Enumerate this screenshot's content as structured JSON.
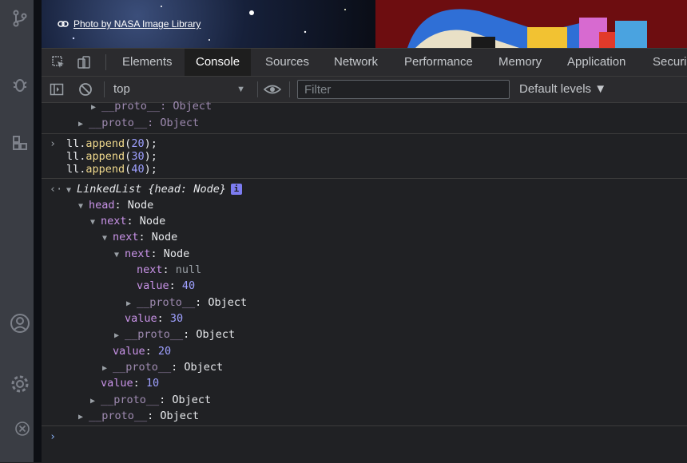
{
  "webpage": {
    "photo_credit": "Photo by NASA Image Library"
  },
  "devtools": {
    "tabs": [
      "Elements",
      "Console",
      "Sources",
      "Network",
      "Performance",
      "Memory",
      "Application",
      "Securi"
    ],
    "active_tab": "Console",
    "context": "top",
    "filter_placeholder": "Filter",
    "levels": "Default levels ▼"
  },
  "console": {
    "partial_proto": "__proto__: Object",
    "proto_top": "__proto__: Object",
    "input_lines": [
      "ll.append(20);",
      "ll.append(30);",
      "ll.append(40);"
    ],
    "result_head": "LinkedList",
    "result_preview": "{head: Node}",
    "info_badge": "i",
    "tree": {
      "head_key": "head",
      "node": "Node",
      "next_key": "next",
      "value_key": "value",
      "proto_key": "__proto__",
      "object": "Object",
      "null": "null",
      "values": [
        "40",
        "30",
        "20",
        "10"
      ]
    }
  },
  "colors": {
    "accent": "#8ab4f8",
    "key": "#c993e8",
    "number": "#9ea0ff",
    "function": "#f0d98c"
  }
}
